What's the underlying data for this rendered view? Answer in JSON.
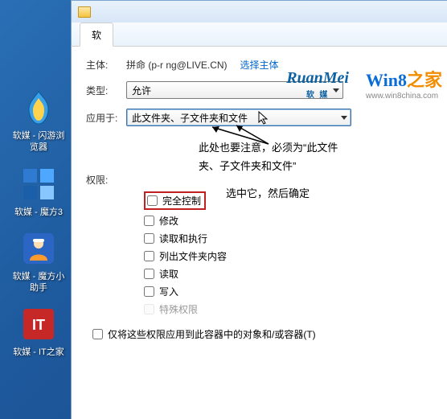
{
  "desktop_icons": [
    {
      "id": "browser",
      "label": "软媒 - 闪游浏\n览器"
    },
    {
      "id": "mofang",
      "label": "软媒 - 魔方3"
    },
    {
      "id": "helper",
      "label": "软媒 - 魔方小\n助手"
    },
    {
      "id": "ithome",
      "label": "软媒 - IT之家"
    }
  ],
  "window": {
    "tab_label": "软"
  },
  "form": {
    "principal_label": "主体:",
    "principal_value": "拼命 (p-r   ng@LIVE.CN)",
    "select_principal_link": "选择主体",
    "type_label": "类型:",
    "type_value": "允许",
    "apply_label": "应用于:",
    "apply_value": "此文件夹、子文件夹和文件"
  },
  "annotations": {
    "apply_note_line1": "此处也要注意，必须为“此文件",
    "apply_note_line2": "夹、子文件夹和文件”",
    "select_note": "选中它，然后确定"
  },
  "permissions": {
    "header": "权限:",
    "items": [
      {
        "key": "full",
        "label": "完全控制",
        "checked": false,
        "enabled": true,
        "highlight": true
      },
      {
        "key": "modify",
        "label": "修改",
        "checked": false,
        "enabled": true
      },
      {
        "key": "readexec",
        "label": "读取和执行",
        "checked": false,
        "enabled": true
      },
      {
        "key": "listfolder",
        "label": "列出文件夹内容",
        "checked": false,
        "enabled": true
      },
      {
        "key": "read",
        "label": "读取",
        "checked": false,
        "enabled": true
      },
      {
        "key": "write",
        "label": "写入",
        "checked": false,
        "enabled": true
      },
      {
        "key": "special",
        "label": "特殊权限",
        "checked": false,
        "enabled": false
      }
    ]
  },
  "apply_only": {
    "label": "仅将这些权限应用到此容器中的对象和/或容器(T)",
    "checked": false
  },
  "watermarks": {
    "ruanmei": "RuanMei",
    "ruanmei_sub": "软 媒",
    "win8": "Win8",
    "win8_suffix": "之家",
    "win8_url": "www.win8china.com"
  },
  "colors": {
    "link": "#0066cc",
    "highlight_border": "#c02020"
  }
}
